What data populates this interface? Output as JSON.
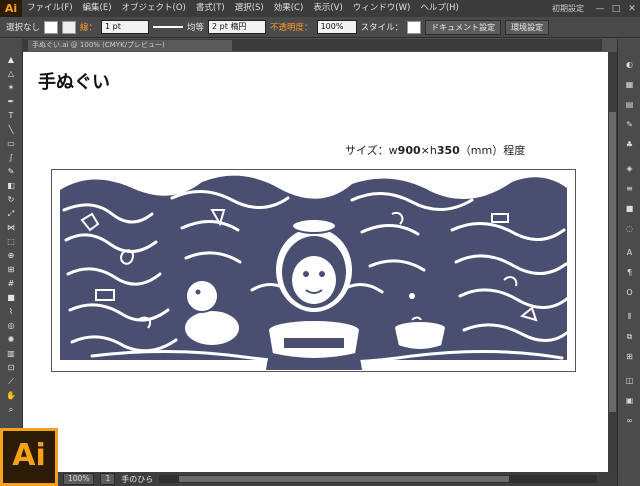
{
  "app": {
    "logo_small": "Ai",
    "logo_large": "Ai",
    "menu": [
      "ファイル(F)",
      "編集(E)",
      "オブジェクト(O)",
      "書式(T)",
      "選択(S)",
      "効果(C)",
      "表示(V)",
      "ウィンドウ(W)",
      "ヘルプ(H)"
    ],
    "workspace": "初期設定",
    "window_buttons": [
      "—",
      "□",
      "✕"
    ]
  },
  "control_bar": {
    "selection_status": "選択なし",
    "stroke_label": "線：",
    "stroke_weight": "1 pt",
    "stroke_style": "均等",
    "brush": "2 pt 楕円",
    "opacity_label": "不透明度：",
    "opacity_value": "100%",
    "style_label": "スタイル：",
    "doc_setup_button": "ドキュメント設定",
    "env_setup_button": "環境設定"
  },
  "document_tab": {
    "name": "手ぬぐい.ai @ 100% (CMYK/プレビュー)"
  },
  "canvas": {
    "title": "手ぬぐい",
    "size_prefix": "サイズ：w",
    "size_w": "900",
    "size_sep": "×h",
    "size_h": "350",
    "size_suffix": "（mm）程度"
  },
  "artwork": {
    "ink_color": "#4a4f72",
    "paper_color": "#ffffff"
  },
  "status_bar": {
    "zoom": "100%",
    "page": "1",
    "tool_name": "手のひら"
  },
  "colors": {
    "ai_orange": "#f7a11a",
    "ai_dark": "#2d1c05",
    "ui_dark": "#4b4b4b"
  }
}
